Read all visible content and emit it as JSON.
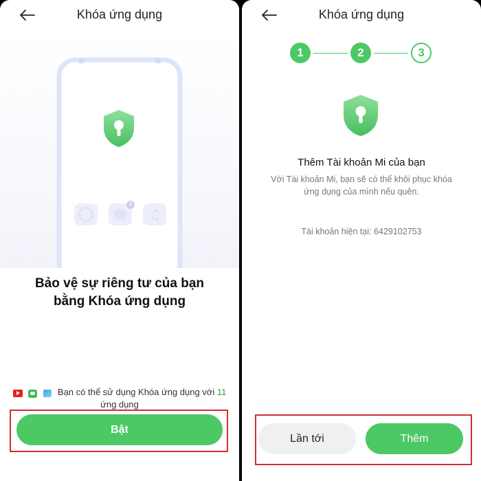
{
  "left_screen": {
    "title": "Khóa ứng dụng",
    "heading_line1": "Bảo vệ sự riêng tư của bạn",
    "heading_line2": "bằng Khóa ứng dụng",
    "apps_text_prefix": "Bạn có thể sử dụng Khóa ứng dụng với ",
    "apps_count": "11",
    "apps_text_suffix": "ứng dụng",
    "message_badge": "3",
    "enable_button": "Bật",
    "icons": [
      "back-arrow-icon",
      "shield-lock-icon",
      "camera-app-icon",
      "message-app-icon",
      "music-app-icon",
      "youtube-icon",
      "line-app-icon",
      "gallery-icon"
    ]
  },
  "right_screen": {
    "title": "Khóa ứng dụng",
    "steps": [
      "1",
      "2",
      "3"
    ],
    "current_step": 2,
    "heading": "Thêm Tài khoản Mi của bạn",
    "description_line1": "Với Tài khoản Mi, bạn sẽ có thể khôi phục khóa",
    "description_line2": "ứng dụng của mình nếu quên.",
    "current_account": "Tài khoản hiện tại: 6429102753",
    "later_button": "Lần tới",
    "add_button": "Thêm"
  },
  "colors": {
    "accent_green": "#4cc864",
    "highlight_red": "#d32f2f",
    "secondary_button": "#f0f0f2"
  }
}
